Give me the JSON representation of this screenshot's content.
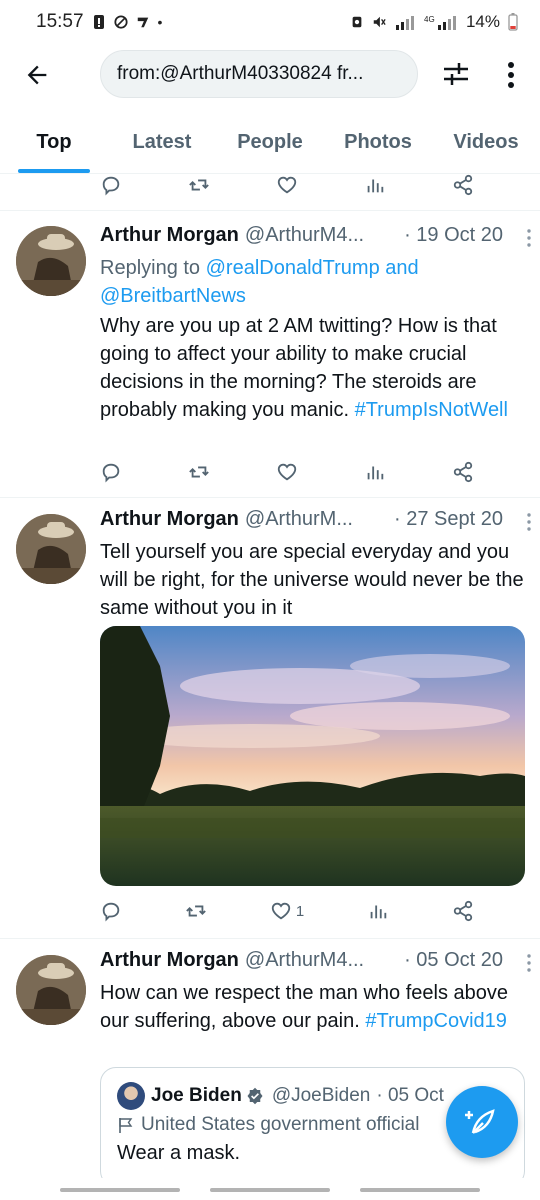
{
  "status_bar": {
    "time": "15:57",
    "battery": "14%"
  },
  "search": {
    "query": "from:@ArthurM40330824 fr..."
  },
  "tabs": [
    {
      "label": "Top",
      "active": true
    },
    {
      "label": "Latest",
      "active": false
    },
    {
      "label": "People",
      "active": false
    },
    {
      "label": "Photos",
      "active": false
    },
    {
      "label": "Videos",
      "active": false
    }
  ],
  "tweets": [
    {
      "name": "Arthur Morgan",
      "handle": "@ArthurM4...",
      "date": "· 19 Oct 20",
      "replying_prefix": "Replying to",
      "replying_to_1": "@realDonaldTrump",
      "replying_and": "and",
      "replying_to_2": "@BreitbartNews",
      "text": "Why are you up at 2 AM twitting? How is that going to affect your ability to make crucial decisions in the morning? The steroids are probably making you manic.",
      "hashtag": "#TrumpIsNotWell",
      "likes": ""
    },
    {
      "name": "Arthur Morgan",
      "handle": "@ArthurM...",
      "date": "· 27 Sept 20",
      "text": "Tell yourself you are special everyday and you will be right, for the universe would never be the same without you in it",
      "likes": "1"
    },
    {
      "name": "Arthur Morgan",
      "handle": "@ArthurM4...",
      "date": "· 05 Oct 20",
      "text": "How can we respect the man who feels above our suffering, above our pain.",
      "hashtag": "#TrumpCovid19",
      "quote": {
        "name": "Joe Biden",
        "handle": "@JoeBiden",
        "date": "· 05 Oct",
        "label": "United States government official",
        "text": "Wear a mask."
      }
    }
  ],
  "colors": {
    "accent": "#1d9bf0",
    "secondary_text": "#536471",
    "primary_text": "#0f1419"
  }
}
